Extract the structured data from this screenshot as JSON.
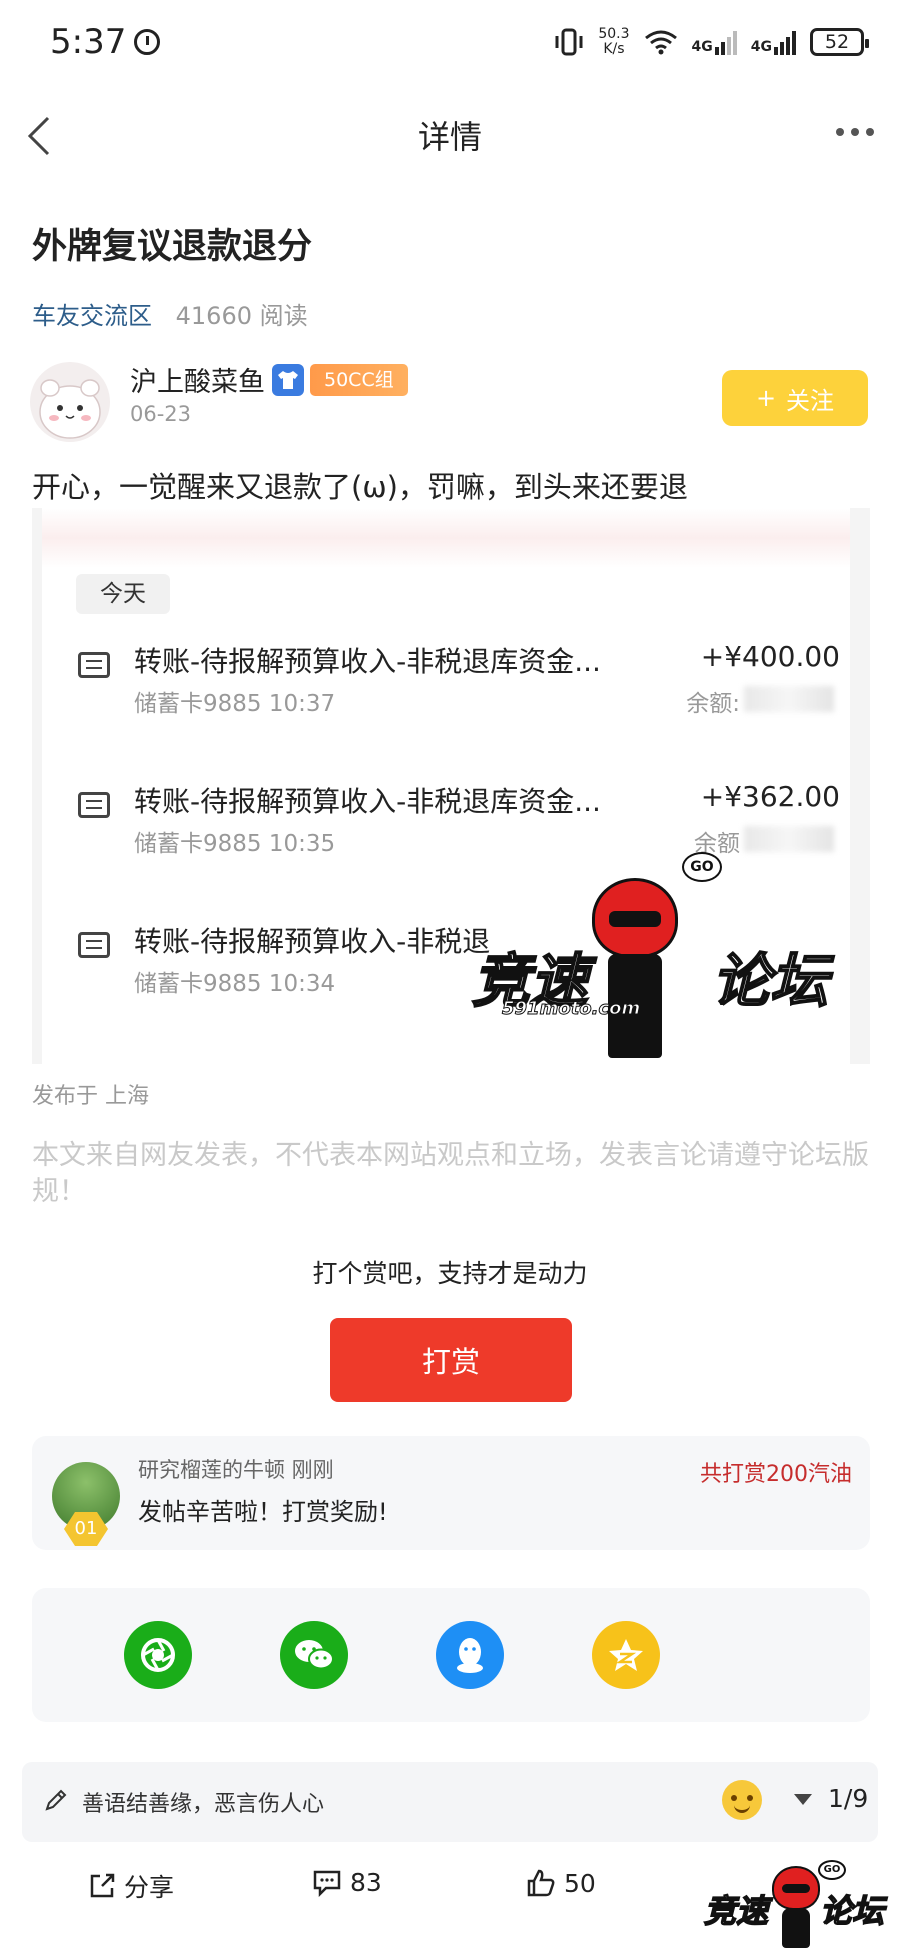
{
  "status_bar": {
    "time": "5:37",
    "net_speed_value": "50.3",
    "net_speed_unit": "K/s",
    "signal1": "4G",
    "signal2": "4G",
    "battery": "52"
  },
  "nav": {
    "title": "详情"
  },
  "post": {
    "title": "外牌复议退款退分",
    "section": "车友交流区",
    "reads": "41660 阅读",
    "author": {
      "name": "沪上酸菜鱼",
      "group": "50CC组",
      "date": "06-23"
    },
    "follow_label": "关注",
    "text": "开心，一觉醒来又退款了(ω)，罚嘛，到头来还要退",
    "image": {
      "today_label": "今天",
      "transactions": [
        {
          "title": "转账-待报解预算收入-非税退库资金...",
          "amount": "+¥400.00",
          "sub": "储蓄卡9885 10:37",
          "balance_label": "余额:"
        },
        {
          "title": "转账-待报解预算收入-非税退库资金...",
          "amount": "+¥362.00",
          "sub": "储蓄卡9885 10:35",
          "balance_label": "余额"
        },
        {
          "title": "转账-待报解预算收入-非税退",
          "amount": "",
          "sub": "储蓄卡9885 10:34",
          "balance_label": ""
        }
      ],
      "watermark": {
        "text_left": "竞速",
        "text_right": "论坛",
        "url": "591moto.com",
        "go": "GO"
      }
    },
    "published": "发布于 上海",
    "disclaimer": "本文来自网友发表，不代表本网站观点和立场，发表言论请遵守论坛版规！"
  },
  "reward": {
    "prompt": "打个赏吧，支持才是动力",
    "button_label": "打赏",
    "record": {
      "name": "研究榴莲的牛顿 刚刚",
      "message": "发帖辛苦啦！打赏奖励!",
      "total": "共打赏200汽油",
      "rank": "01"
    }
  },
  "share_icons": [
    {
      "icon": "moments-icon",
      "color": "#1aad19"
    },
    {
      "icon": "wechat-icon",
      "color": "#1aad19"
    },
    {
      "icon": "qq-icon",
      "color": "#1e8ff5"
    },
    {
      "icon": "qzone-icon",
      "color": "#f7c21a"
    }
  ],
  "comment_bar": {
    "placeholder": "善语结善缘，恶言伤人心",
    "page": "1/9"
  },
  "bottom_bar": {
    "share_label": "分享",
    "comments": "83",
    "likes": "50"
  },
  "colors": {
    "follow": "#fdd23b",
    "reward_button": "#ee3a2a",
    "section_link": "#2d5d8a",
    "reward_total": "#c62d2d"
  }
}
